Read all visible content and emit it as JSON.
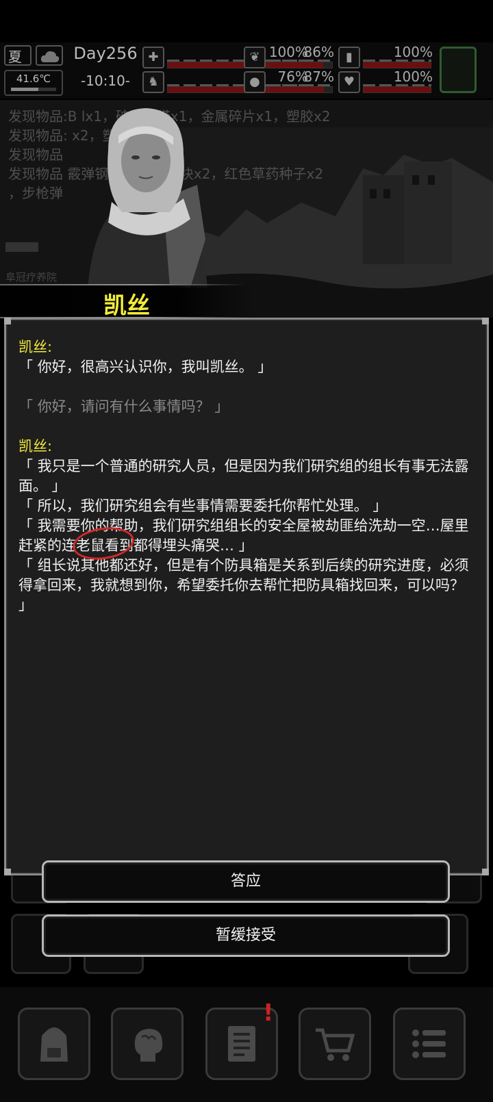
{
  "status": {
    "season": "夏",
    "temperature": "41.6℃",
    "temperature_level": 0.6,
    "day": "Day256",
    "clock": "-10:10-",
    "stats": [
      {
        "name": "health-icon",
        "value": "100%",
        "level": 1.0
      },
      {
        "name": "stomach-icon",
        "value": "86%",
        "level": 0.86
      },
      {
        "name": "energy-icon",
        "value": "100%",
        "level": 1.0
      },
      {
        "name": "stamina-icon",
        "value": "76%",
        "level": 0.76
      },
      {
        "name": "water-icon",
        "value": "87%",
        "level": 0.87
      },
      {
        "name": "heart-icon",
        "value": "100%",
        "level": 1.0
      }
    ]
  },
  "log": [
    "发现物品:B         lx1，破布绷带x1，金属碎片x1，塑胶x2",
    "发现物品:            x2，塑胶x3",
    "发现物品",
    "发现物品                霰弹钢珠x3，金属块x2，红色草药种子x2",
    "，步枪弹"
  ],
  "place": "阜冠疗养院",
  "npc_name": "凯丝",
  "dialog": {
    "speaker1": "凯丝:",
    "line1": "「 你好，很高兴认识你，我叫凯丝。 」",
    "player1": "「 你好，请问有什么事情吗？ 」",
    "speaker2": "凯丝:",
    "line2": "「 我只是一个普通的研究人员，但是因为我们研究组的组长有事无法露面。 」",
    "line3": "「 所以，我们研究组会有些事情需要委托你帮忙处理。 」",
    "line4": "「 我需要你的帮助，我们研究组组长的安全屋被劫匪给洗劫一空…屋里赶紧的连老鼠看到都得埋头痛哭… 」",
    "line5": "「 组长说其他都还好，但是有个防具箱是关系到后续的研究进度，必须得拿回来，我就想到你，希望委托你去帮忙把防具箱找回来，可以吗？ 」"
  },
  "choices": {
    "accept": "答应",
    "postpone": "暂缓接受"
  },
  "colors": {
    "name": "#f3ec3a",
    "annotation": "#d12a2a",
    "bar_fill": "#6d0e0e"
  },
  "nav": [
    "backpack-icon",
    "brain-icon",
    "notebook-icon",
    "cart-icon",
    "menu-icon"
  ]
}
